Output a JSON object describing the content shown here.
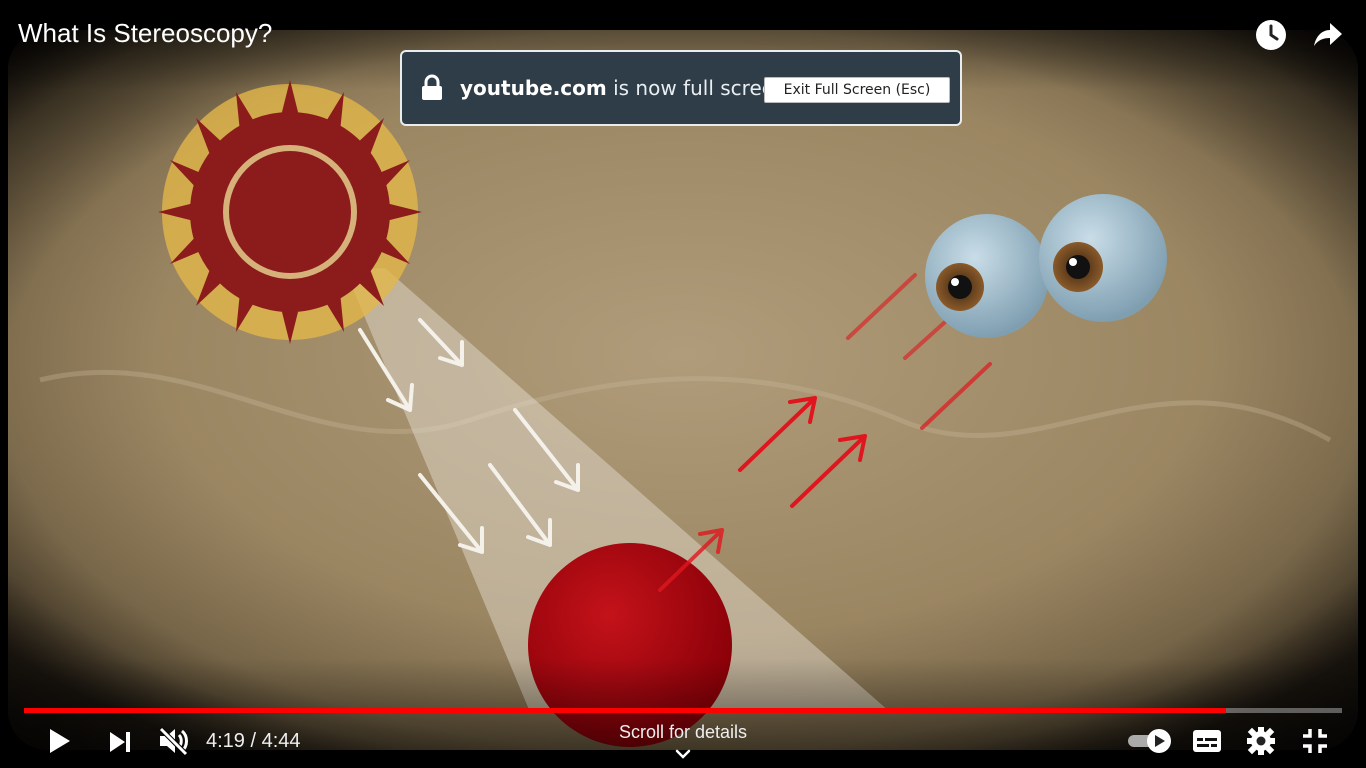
{
  "video": {
    "title": "What Is Stereoscopy?"
  },
  "fullscreen_notice": {
    "domain": "youtube.com",
    "message": " is now full screen",
    "exit_button_label": "Exit Full Screen (Esc)"
  },
  "player": {
    "current_time": "4:19",
    "duration": "4:44",
    "time_separator": " / ",
    "progress_fraction": 0.912,
    "scroll_hint": "Scroll for details",
    "muted": true,
    "autoplay_on": true
  },
  "icons": {
    "watch_later": "clock-icon",
    "share": "share-arrow-icon",
    "play": "play-icon",
    "next": "next-icon",
    "mute": "muted-volume-icon",
    "autoplay": "autoplay-toggle-icon",
    "subtitles": "subtitles-icon",
    "settings": "gear-icon",
    "exit_fullscreen": "exit-fullscreen-icon",
    "lock": "lock-icon",
    "chevron": "chevron-down-icon"
  },
  "colors": {
    "progress_played": "#ff0000",
    "banner_bg": "#2f3d48"
  }
}
